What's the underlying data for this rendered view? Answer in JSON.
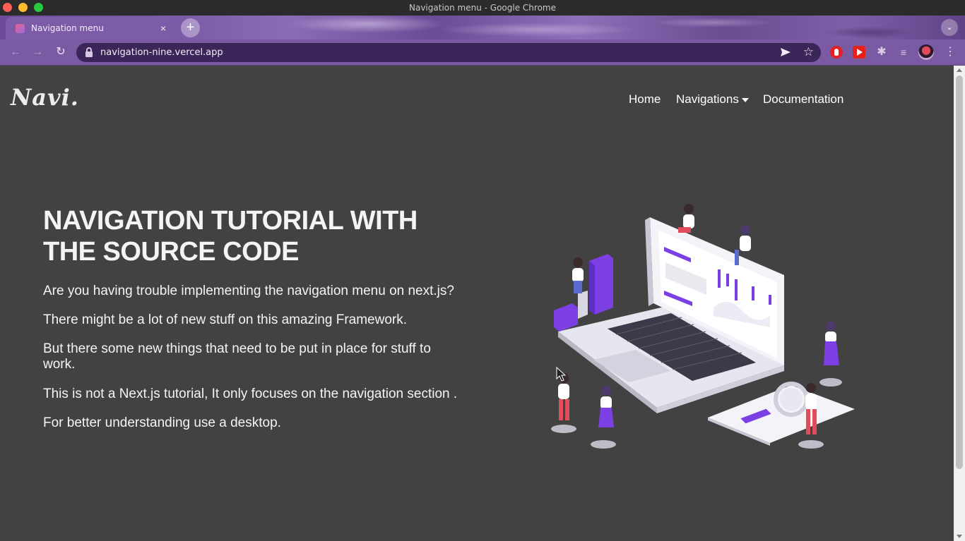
{
  "window": {
    "title": "Navigation menu - Google Chrome"
  },
  "tabs": [
    {
      "title": "Navigation menu",
      "close": "×"
    }
  ],
  "tabstrip": {
    "new_tab": "+",
    "tab_search": "⌄"
  },
  "toolbar": {
    "back": "←",
    "forward": "→",
    "reload": "↻",
    "url": "navigation-nine.vercel.app",
    "star": "☆",
    "puzzle": "✱",
    "media": "≡",
    "menu": "⋮"
  },
  "site": {
    "logo": "Navi.",
    "nav": {
      "home": "Home",
      "navigations": "Navigations",
      "documentation": "Documentation"
    },
    "headline_line1": "NAVIGATION TUTORIAL WITH",
    "headline_line2": "THE SOURCE CODE",
    "paragraphs": [
      "Are you having trouble implementing the navigation menu on next.js?",
      "There might be a lot of new stuff on this amazing Framework.",
      "But there some new things that need to be put in place for stuff to work.",
      "This is not a Next.js tutorial, It only focuses on the navigation section .",
      "For better understanding use a desktop."
    ]
  },
  "colors": {
    "page_bg": "#424242",
    "accent_purple": "#7b3fe4",
    "text": "#f4f4f4"
  }
}
